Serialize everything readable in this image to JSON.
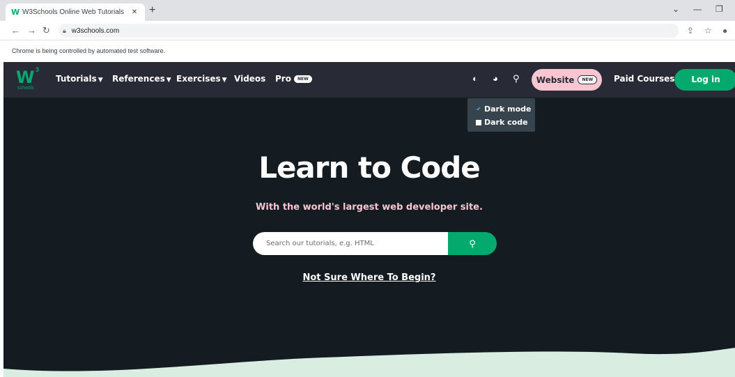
{
  "browser": {
    "tab_title": "W3Schools Online Web Tutorials",
    "tab_favicon": "W",
    "tab_close": "✕",
    "new_tab": "+",
    "url": "w3schools.com",
    "infobar_text": "Chrome is being controlled by automated test software."
  },
  "nav": {
    "logo_text": "schools",
    "logo_superscript": "3",
    "items": [
      {
        "label": "Tutorials",
        "has_caret": true
      },
      {
        "label": "References",
        "has_caret": true
      },
      {
        "label": "Exercises",
        "has_caret": true
      },
      {
        "label": "Videos",
        "has_caret": false
      },
      {
        "label": "Pro",
        "badge": "NEW"
      }
    ],
    "website_button": {
      "label": "Website",
      "badge": "NEW"
    },
    "paid_courses": "Paid Courses",
    "login": "Log in"
  },
  "dropdown": {
    "items": [
      {
        "label": "Dark mode",
        "checked": true
      },
      {
        "label": "Dark code",
        "checked": false
      }
    ]
  },
  "hero": {
    "headline": "Learn to Code",
    "tagline": "With the world's largest web developer site.",
    "search_placeholder": "Search our tutorials, e.g. HTML",
    "not_sure": "Not Sure Where To Begin?"
  },
  "colors": {
    "nav_bg": "#282a35",
    "hero_bg": "#141b21",
    "accent_green": "#04aa6d",
    "accent_pink": "#f7c6d0",
    "wave": "#d9eee1"
  }
}
